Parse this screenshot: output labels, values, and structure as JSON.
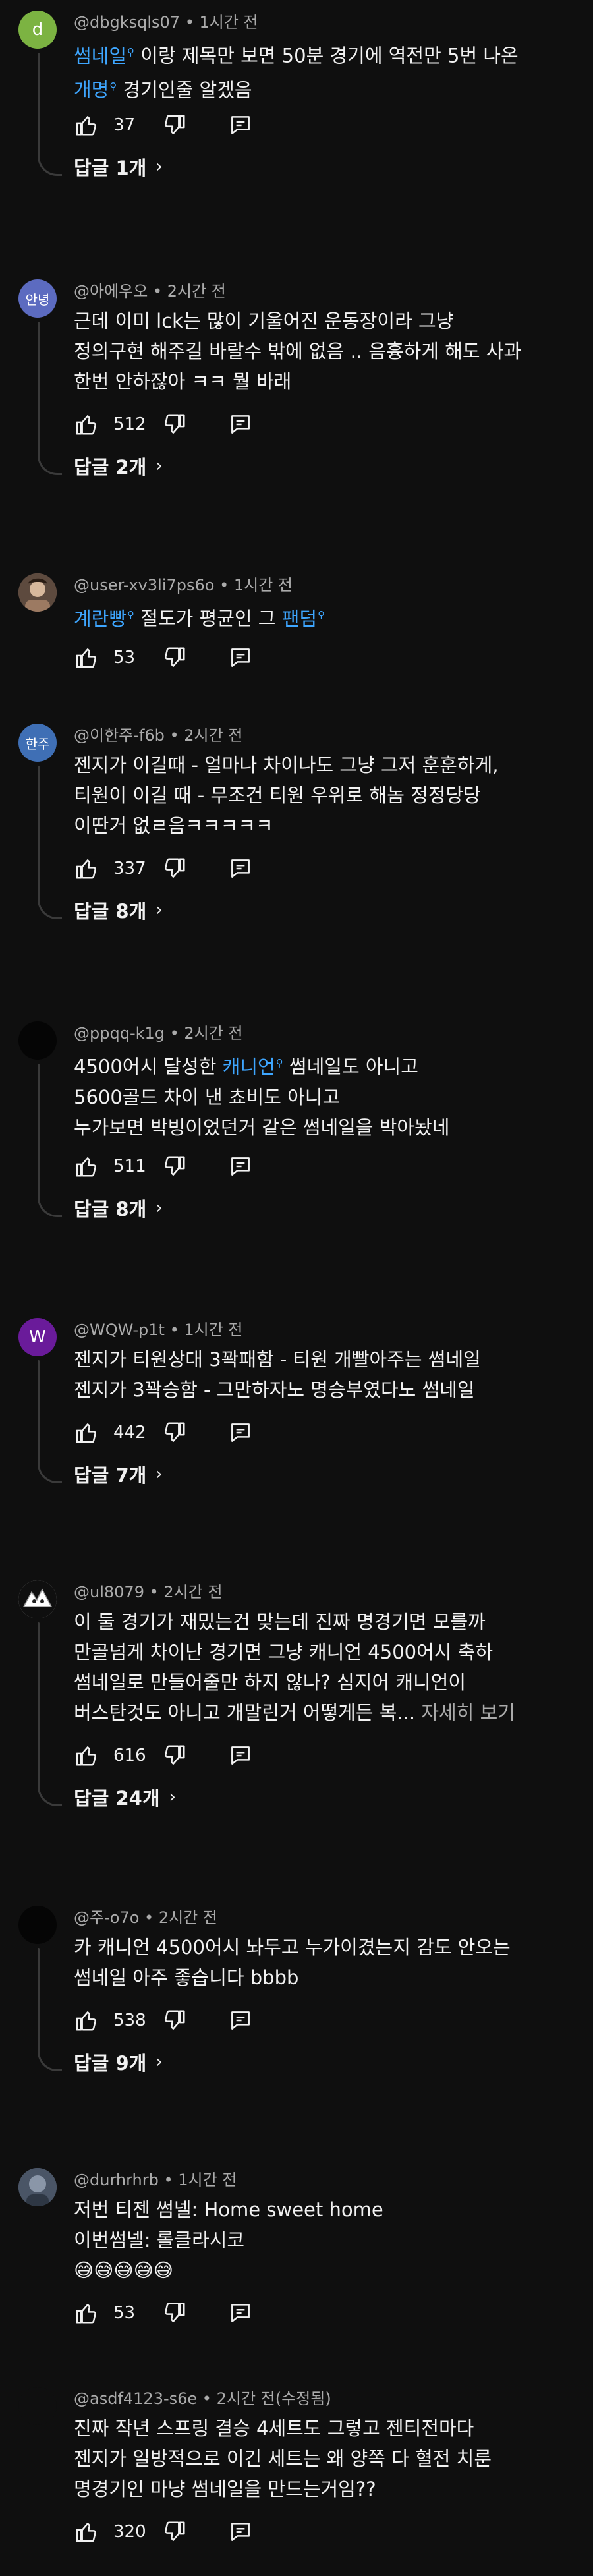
{
  "comments": [
    {
      "id": "c1",
      "avatar_letter": "d",
      "avatar_color": "#7cb342",
      "author": "@dbgksqls07",
      "time": "1시간 전",
      "lines": [
        [
          {
            "t": "썸네일",
            "link": true
          },
          {
            "t": " 이랑 제목만 보면 50분 경기에 역전만 5번 나온"
          }
        ],
        [
          {
            "t": "개명",
            "link": true
          },
          {
            "t": " 경기인줄 알겠음"
          }
        ]
      ],
      "likes": "37",
      "replies": "답글 1개"
    },
    {
      "id": "c2",
      "avatar_letter": "안녕",
      "avatar_color": "#5c6bc0",
      "author": "@아에우오",
      "time": "2시간 전",
      "lines": [
        [
          {
            "t": "근데 이미 lck는 많이 기울어진 운동장이라 그냥"
          }
        ],
        [
          {
            "t": "정의구현 해주길 바랄수 밖에 없음 .. 음흉하게 해도 사과"
          }
        ],
        [
          {
            "t": "한번 안하잖아 ㅋㅋ 뭘 바래"
          }
        ]
      ],
      "likes": "512",
      "replies": "답글 2개"
    },
    {
      "id": "c3",
      "avatar_letter": "",
      "avatar_color": "#8d6e63",
      "author": "@user-xv3li7ps6o",
      "time": "1시간 전",
      "lines": [
        [
          {
            "t": "계란빵",
            "link": true
          },
          {
            "t": " 절도가 평균인 그 "
          },
          {
            "t": "팬덤",
            "link": true
          }
        ]
      ],
      "likes": "53",
      "replies": ""
    },
    {
      "id": "c4",
      "avatar_letter": "한주",
      "avatar_color": "#3f6fb5",
      "author": "@이한주-f6b",
      "time": "2시간 전",
      "lines": [
        [
          {
            "t": "젠지가 이길때 - 얼마나 차이나도 그냥 그저 훈훈하게,"
          }
        ],
        [
          {
            "t": "티원이 이길 때 - 무조건 티원 우위로 해놈 정정당당"
          }
        ],
        [
          {
            "t": "이딴거 없ㄹ음ㅋㅋㅋㅋㅋ"
          }
        ]
      ],
      "likes": "337",
      "replies": "답글 8개"
    },
    {
      "id": "c5",
      "avatar_letter": "",
      "avatar_color": "#050505",
      "author": "@ppqq-k1g",
      "time": "2시간 전",
      "lines": [
        [
          {
            "t": "4500어시 달성한 "
          },
          {
            "t": "캐니언",
            "link": true
          },
          {
            "t": " 썸네일도 아니고"
          }
        ],
        [
          {
            "t": "5600골드 차이 낸 쵸비도 아니고"
          }
        ],
        [
          {
            "t": "누가보면 박빙이었던거 같은 썸네일을 박아놨네"
          }
        ]
      ],
      "likes": "511",
      "replies": "답글 8개"
    },
    {
      "id": "c6",
      "avatar_letter": "W",
      "avatar_color": "#6a1b9a",
      "author": "@WQW-p1t",
      "time": "1시간 전",
      "lines": [
        [
          {
            "t": "젠지가 티원상대 3꽉패함 - 티원 개빨아주는 썸네일"
          }
        ],
        [
          {
            "t": "젠지가 3꽉승함 - 그만하자노 명승부였다노 썸네일"
          }
        ]
      ],
      "likes": "442",
      "replies": "답글 7개"
    },
    {
      "id": "c7",
      "avatar_letter": "",
      "avatar_color": "#e0e0e0",
      "author": "@ul8079",
      "time": "2시간 전",
      "lines": [
        [
          {
            "t": "이 둘 경기가 재밌는건 맞는데 진짜 명경기면 모를까"
          }
        ],
        [
          {
            "t": "만골넘게 차이난 경기면 그냥 캐니언 4500어시 축하"
          }
        ],
        [
          {
            "t": "썸네일로 만들어줄만 하지 않나? 심지어 캐니언이"
          }
        ],
        [
          {
            "t": "버스탄것도 아니고 개말린거 어떻게든 복... "
          },
          {
            "t": "자세히 보기",
            "more": true
          }
        ]
      ],
      "likes": "616",
      "replies": "답글 24개"
    },
    {
      "id": "c8",
      "avatar_letter": "",
      "avatar_color": "#050505",
      "author": "@주-o7o",
      "time": "2시간 전",
      "lines": [
        [
          {
            "t": "카 캐니언 4500어시 놔두고 누가이겼는지 감도 안오는"
          }
        ],
        [
          {
            "t": "썸네일 아주 좋습니다 bbbb"
          }
        ]
      ],
      "likes": "538",
      "replies": "답글 9개"
    },
    {
      "id": "c9",
      "avatar_letter": "",
      "avatar_color": "#4a5566",
      "author": "@durhrhrb",
      "time": "1시간 전",
      "lines": [
        [
          {
            "t": "저번 티젠 썸넬: Home sweet home"
          }
        ],
        [
          {
            "t": "이번썸넬: 롤클라시코"
          }
        ],
        [
          {
            "t": "😅😅😅😅😅"
          }
        ]
      ],
      "likes": "53",
      "replies": ""
    },
    {
      "id": "c10",
      "avatar_letter": "",
      "avatar_color": "#0f0f0f",
      "author": "@asdf4123-s6e",
      "time": "2시간 전(수정됨)",
      "lines": [
        [
          {
            "t": "진짜 작년 스프링 결승 4세트도 그렇고 젠티전마다"
          }
        ],
        [
          {
            "t": "젠지가 일방적으로 이긴 세트는 왜 양쪽 다 혈전 치룬"
          }
        ],
        [
          {
            "t": "명경기인 마냥 썸네일을 만드는거임??"
          }
        ]
      ],
      "likes": "320",
      "replies": ""
    }
  ]
}
